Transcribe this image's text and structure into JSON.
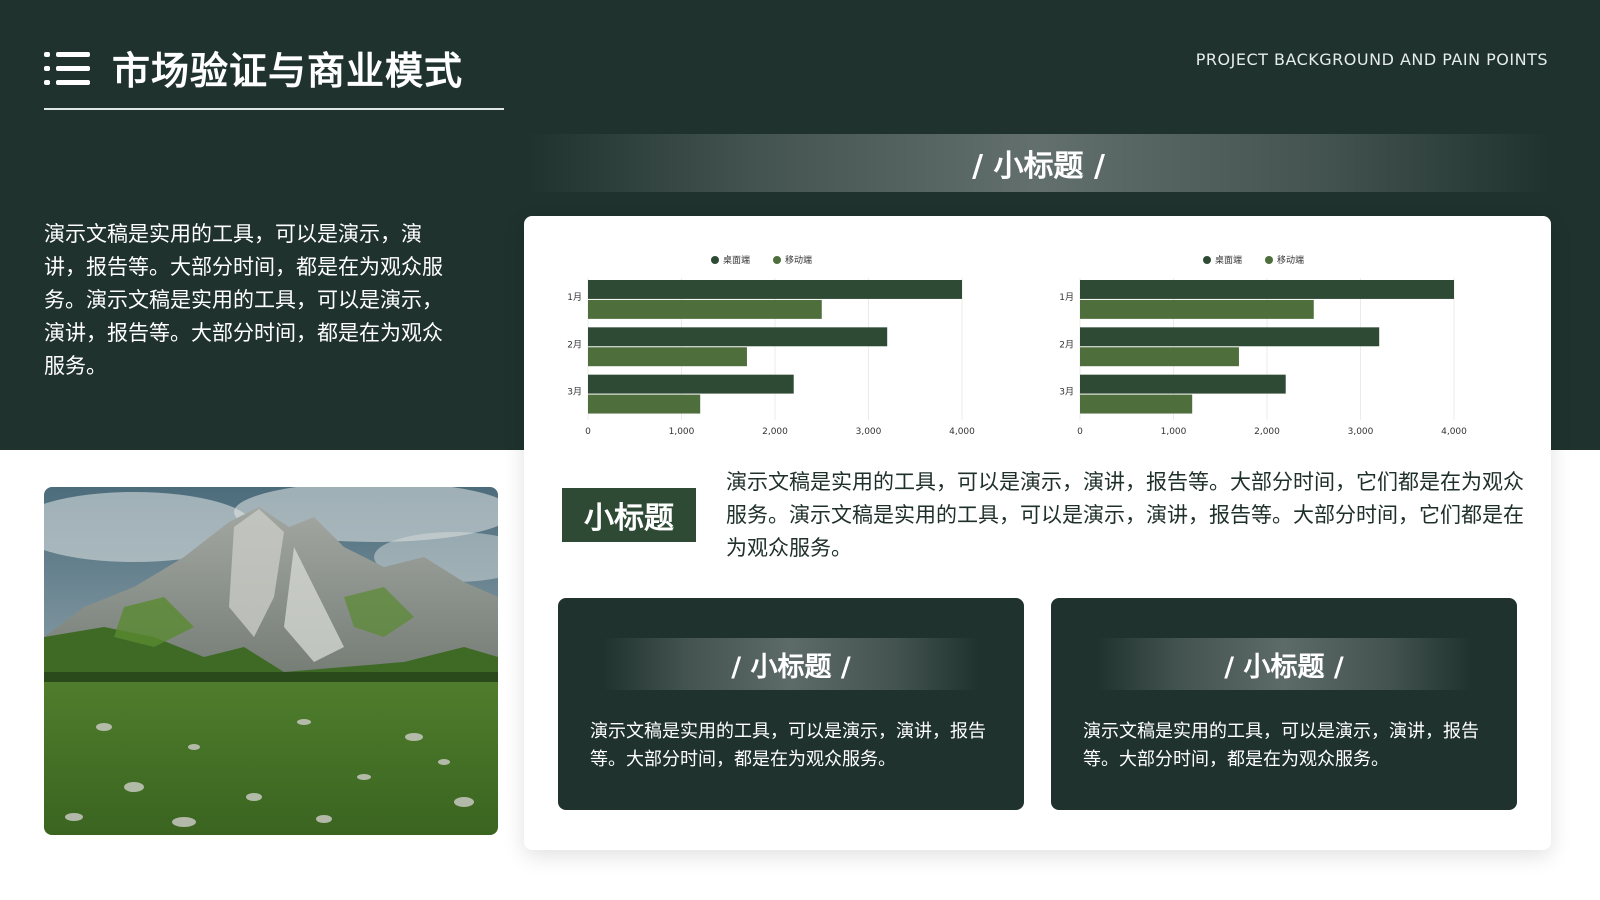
{
  "header": {
    "title": "市场验证与商业模式",
    "subtitle": "PROJECT BACKGROUND AND PAIN POINTS",
    "menu_icon": "list-icon"
  },
  "intro": {
    "text": "演示文稿是实用的工具，可以是演示，演讲，报告等。大部分时间，都是在为观众服务。演示文稿是实用的工具，可以是演示，演讲，报告等。大部分时间，都是在为观众服务。"
  },
  "banner": {
    "title": "/ 小标题 /"
  },
  "colors": {
    "dark": "#1f322e",
    "desktop": "#2e4a35",
    "mobile": "#4e6e3b",
    "card": "#ffffff"
  },
  "chart_data": [
    {
      "type": "bar",
      "orientation": "horizontal",
      "categories": [
        "1月",
        "2月",
        "3月"
      ],
      "series": [
        {
          "name": "桌面端",
          "values": [
            4000,
            3200,
            2200
          ],
          "color": "#2e4a35"
        },
        {
          "name": "移动端",
          "values": [
            2500,
            1700,
            1200
          ],
          "color": "#4e6e3b"
        }
      ],
      "xlim": [
        0,
        4000
      ],
      "x_ticks": [
        "0",
        "1,000",
        "2,000",
        "3,000",
        "4,000"
      ],
      "grid": true,
      "legend": "top-center"
    },
    {
      "type": "bar",
      "orientation": "horizontal",
      "categories": [
        "1月",
        "2月",
        "3月"
      ],
      "series": [
        {
          "name": "桌面端",
          "values": [
            4000,
            3200,
            2200
          ],
          "color": "#2e4a35"
        },
        {
          "name": "移动端",
          "values": [
            2500,
            1700,
            1200
          ],
          "color": "#4e6e3b"
        }
      ],
      "xlim": [
        0,
        4000
      ],
      "x_ticks": [
        "0",
        "1,000",
        "2,000",
        "3,000",
        "4,000"
      ],
      "grid": true,
      "legend": "top-center"
    }
  ],
  "subsection": {
    "badge": "小标题",
    "text": "演示文稿是实用的工具，可以是演示，演讲，报告等。大部分时间，它们都是在为观众服务。演示文稿是实用的工具，可以是演示，演讲，报告等。大部分时间，它们都是在为观众服务。"
  },
  "cards": [
    {
      "title": "/ 小标题 /",
      "text": "演示文稿是实用的工具，可以是演示，演讲，报告等。大部分时间，都是在为观众服务。"
    },
    {
      "title": "/ 小标题 /",
      "text": "演示文稿是实用的工具，可以是演示，演讲，报告等。大部分时间，都是在为观众服务。"
    }
  ]
}
